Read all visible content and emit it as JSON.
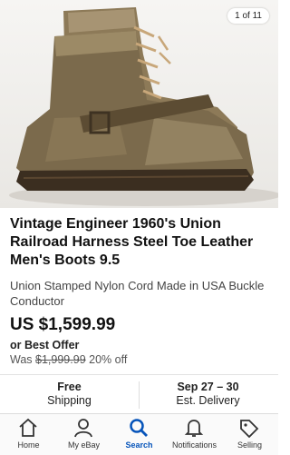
{
  "photo": {
    "counter": "1 of 11"
  },
  "listing": {
    "title": "Vintage Engineer 1960's Union Railroad Harness Steel Toe Leather Men's Boots 9.5",
    "subtitle": "Union Stamped Nylon Cord Made in USA Buckle Conductor",
    "price": "US $1,599.99",
    "offer": "or Best Offer",
    "was_label": "Was",
    "was_price": "$1,999.99",
    "discount": "20% off"
  },
  "info": {
    "shipping_top": "Free",
    "shipping_bottom": "Shipping",
    "delivery_top": "Sep 27 – 30",
    "delivery_bottom": "Est. Delivery"
  },
  "tabbar": {
    "items": [
      {
        "label": "Home",
        "icon": "home-icon"
      },
      {
        "label": "My eBay",
        "icon": "person-icon"
      },
      {
        "label": "Search",
        "icon": "search-icon"
      },
      {
        "label": "Notifications",
        "icon": "bell-icon"
      },
      {
        "label": "Selling",
        "icon": "tag-icon"
      }
    ],
    "active": "Search"
  },
  "colors": {
    "accent": "#0654ba",
    "text": "#111111",
    "muted": "#555555"
  }
}
